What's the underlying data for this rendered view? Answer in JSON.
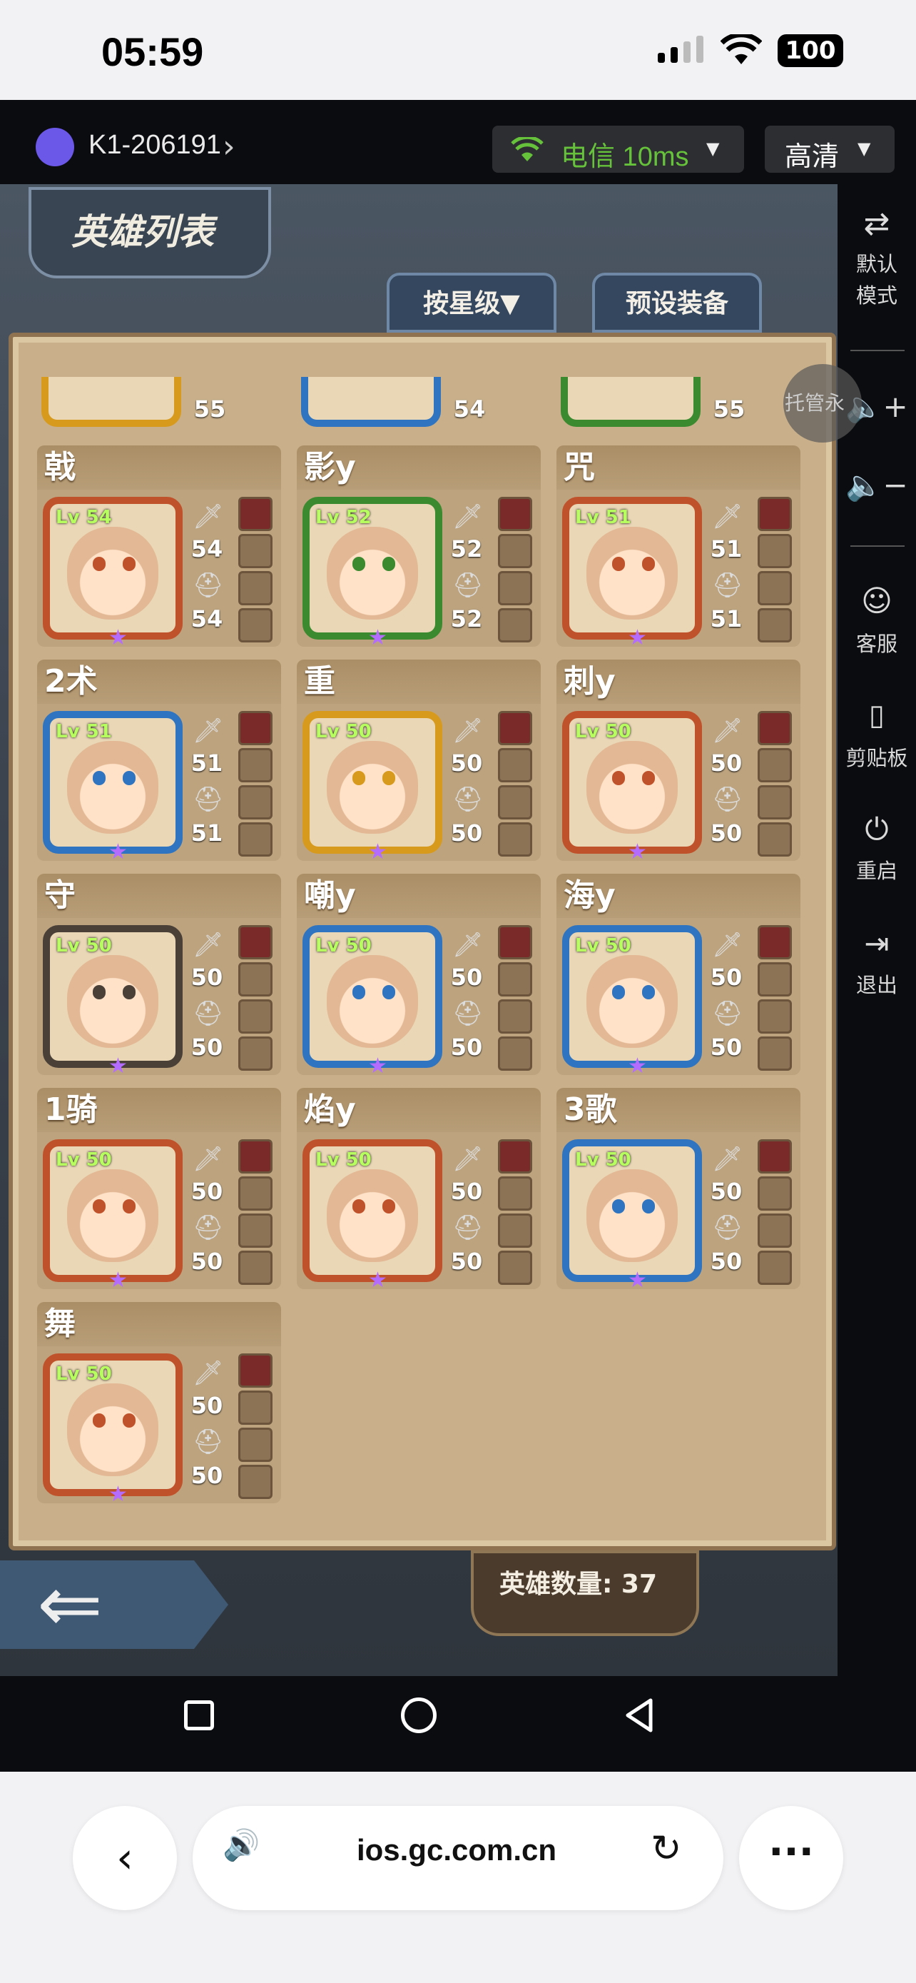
{
  "status_bar": {
    "time": "05:59",
    "battery": "100"
  },
  "cloud_header": {
    "device_name": "K1-206191",
    "network_label": "电信 10ms",
    "quality_label": "高清"
  },
  "side_panel": {
    "items": [
      {
        "label": "默认\n模式",
        "icon": "swap-arrows-icon"
      },
      {
        "label": "",
        "icon": "volume-up-icon"
      },
      {
        "label": "",
        "icon": "volume-down-icon"
      },
      {
        "label": "客服",
        "icon": "support-icon"
      },
      {
        "label": "剪贴板",
        "icon": "clipboard-icon"
      },
      {
        "label": "重启",
        "icon": "power-icon"
      },
      {
        "label": "退出",
        "icon": "exit-icon"
      }
    ]
  },
  "game": {
    "title": "英雄列表",
    "tabs": [
      "按星级▼",
      "预设装备"
    ],
    "hosting_label": "托管永",
    "count_label": "英雄数量: 37",
    "partial_row": [
      {
        "stat": "55"
      },
      {
        "stat": "54"
      },
      {
        "stat": "55"
      }
    ],
    "heroes": [
      {
        "name": "戟",
        "lv": "Lv 54",
        "atk": "54",
        "def": "54",
        "frame": "#c0522b"
      },
      {
        "name": "影y",
        "lv": "Lv 52",
        "atk": "52",
        "def": "52",
        "frame": "#3c8a2f"
      },
      {
        "name": "咒",
        "lv": "Lv 51",
        "atk": "51",
        "def": "51",
        "frame": "#c0522b"
      },
      {
        "name": "2术",
        "lv": "Lv 51",
        "atk": "51",
        "def": "51",
        "frame": "#2f74c0"
      },
      {
        "name": "重",
        "lv": "Lv 50",
        "atk": "50",
        "def": "50",
        "frame": "#d79a1d"
      },
      {
        "name": "刺y",
        "lv": "Lv 50",
        "atk": "50",
        "def": "50",
        "frame": "#c0522b"
      },
      {
        "name": "守",
        "lv": "Lv 50",
        "atk": "50",
        "def": "50",
        "frame": "#4a4038"
      },
      {
        "name": "嘲y",
        "lv": "Lv 50",
        "atk": "50",
        "def": "50",
        "frame": "#2f74c0"
      },
      {
        "name": "海y",
        "lv": "Lv 50",
        "atk": "50",
        "def": "50",
        "frame": "#2f74c0"
      },
      {
        "name": "1骑",
        "lv": "Lv 50",
        "atk": "50",
        "def": "50",
        "frame": "#c0522b"
      },
      {
        "name": "焰y",
        "lv": "Lv 50",
        "atk": "50",
        "def": "50",
        "frame": "#c0522b"
      },
      {
        "name": "3歌",
        "lv": "Lv 50",
        "atk": "50",
        "def": "50",
        "frame": "#2f74c0"
      },
      {
        "name": "舞",
        "lv": "Lv 50",
        "atk": "50",
        "def": "50",
        "frame": "#c0522b"
      }
    ]
  },
  "safari": {
    "url": "ios.gc.com.cn"
  }
}
